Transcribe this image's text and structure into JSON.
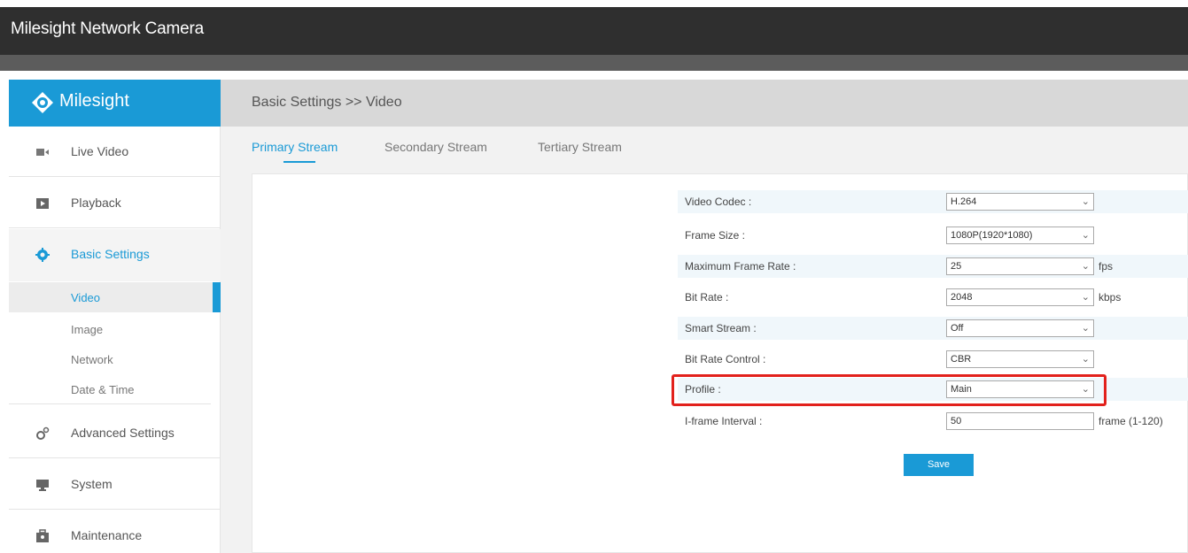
{
  "app": {
    "title": "Milesight Network Camera"
  },
  "brand": {
    "name": "Milesight",
    "accent": "#1a9ad6",
    "highlight": "#e2211c"
  },
  "sidebar": {
    "items": [
      {
        "label": "Live Video",
        "icon": "video-camera-icon"
      },
      {
        "label": "Playback",
        "icon": "playback-icon"
      },
      {
        "label": "Basic Settings",
        "icon": "gear-icon",
        "active": true
      },
      {
        "label": "Advanced Settings",
        "icon": "gears-icon"
      },
      {
        "label": "System",
        "icon": "monitor-icon"
      },
      {
        "label": "Maintenance",
        "icon": "toolbox-icon"
      }
    ],
    "subitems": [
      {
        "label": "Video",
        "active": true
      },
      {
        "label": "Image"
      },
      {
        "label": "Network"
      },
      {
        "label": "Date & Time"
      }
    ]
  },
  "breadcrumb": "Basic Settings >> Video",
  "tabs": [
    {
      "label": "Primary Stream",
      "active": true
    },
    {
      "label": "Secondary Stream"
    },
    {
      "label": "Tertiary Stream"
    }
  ],
  "form": {
    "rows": [
      {
        "label": "Video Codec :",
        "value": "H.264",
        "type": "select",
        "unit": ""
      },
      {
        "label": "Frame Size :",
        "value": "1080P(1920*1080)",
        "type": "select",
        "unit": ""
      },
      {
        "label": "Maximum Frame Rate :",
        "value": "25",
        "type": "select",
        "unit": "fps"
      },
      {
        "label": "Bit Rate :",
        "value": "2048",
        "type": "select",
        "unit": "kbps"
      },
      {
        "label": "Smart Stream :",
        "value": "Off",
        "type": "select",
        "unit": ""
      },
      {
        "label": "Bit Rate Control :",
        "value": "CBR",
        "type": "select",
        "unit": ""
      },
      {
        "label": "Profile :",
        "value": "Main",
        "type": "select",
        "unit": ""
      },
      {
        "label": "I-frame Interval :",
        "value": "50",
        "type": "input",
        "unit": "frame (1-120)"
      }
    ],
    "save_label": "Save"
  }
}
